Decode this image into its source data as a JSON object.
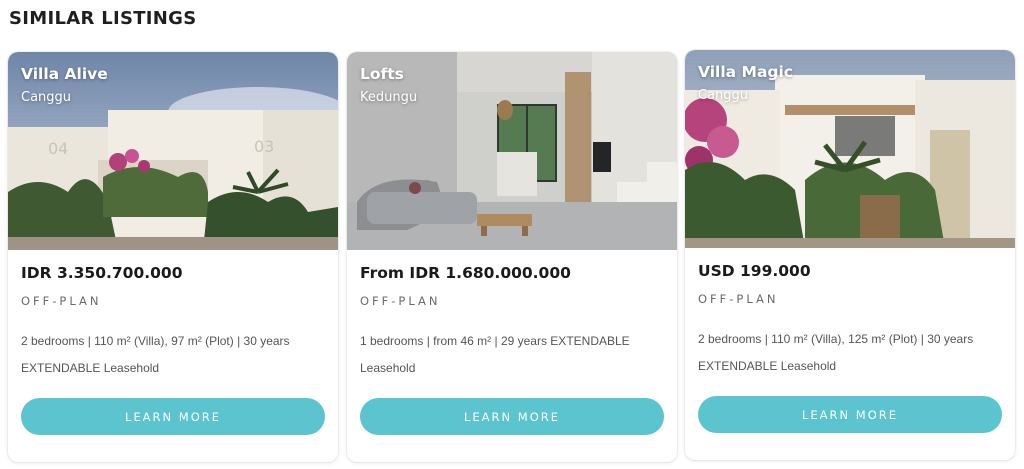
{
  "section": {
    "title": "SIMILAR LISTINGS"
  },
  "accent_color": "#5bc4cf",
  "listings": [
    {
      "title": "Villa Alive",
      "location": "Canggu",
      "price": "IDR 3.350.700.000",
      "status": "OFF-PLAN",
      "description": "2 bedrooms | 110 m² (Villa), 97 m² (Plot) | 30 years EXTENDABLE Leasehold",
      "button_label": "LEARN MORE"
    },
    {
      "title": "Lofts",
      "location": "Kedungu",
      "price": "From IDR 1.680.000.000",
      "status": "OFF-PLAN",
      "description": "1 bedrooms | from 46 m² | 29 years EXTENDABLE Leasehold",
      "button_label": "LEARN MORE"
    },
    {
      "title": "Villa Magic",
      "location": "Canggu",
      "price": "USD 199.000",
      "status": "OFF-PLAN",
      "description": "2 bedrooms | 110 m² (Villa), 125 m² (Plot) | 30 years EXTENDABLE Leasehold",
      "button_label": "LEARN MORE"
    }
  ]
}
